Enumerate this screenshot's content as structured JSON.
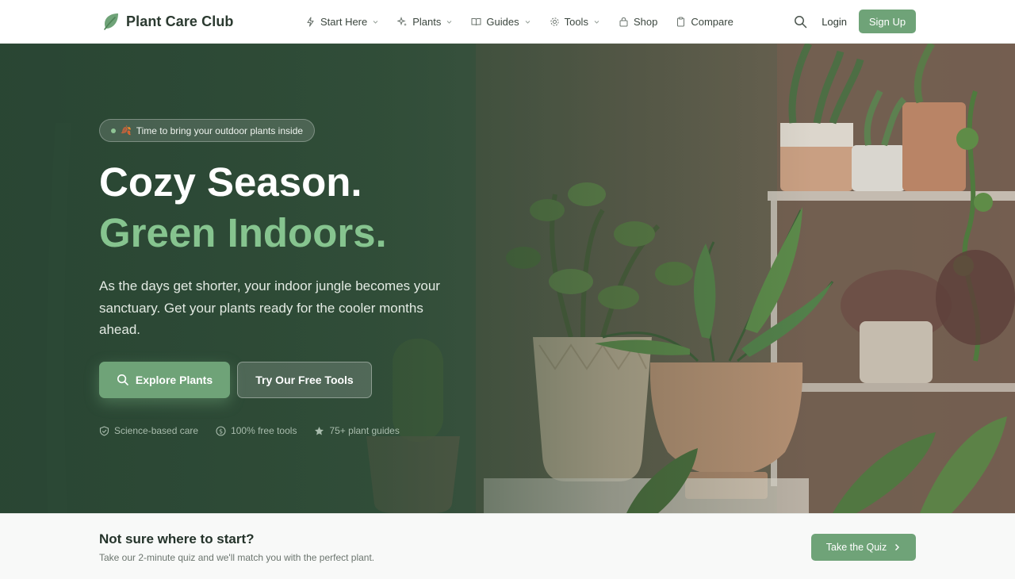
{
  "nav": {
    "brand": "Plant Care Club",
    "logo_icon": "leaf-logo-icon",
    "links": [
      {
        "label": "Start Here",
        "icon": "sparkle-icon",
        "dropdown": true
      },
      {
        "label": "Plants",
        "icon": "sparkles-icon",
        "dropdown": true
      },
      {
        "label": "Guides",
        "icon": "book-icon",
        "dropdown": true
      },
      {
        "label": "Tools",
        "icon": "gear-icon",
        "dropdown": true
      },
      {
        "label": "Shop",
        "icon": "bag-icon",
        "dropdown": false
      },
      {
        "label": "Compare",
        "icon": "clipboard-icon",
        "dropdown": false
      }
    ],
    "search_icon": "search-icon",
    "login": "Login",
    "signup": "Sign Up"
  },
  "hero": {
    "pill": "Time to bring your outdoor plants inside",
    "pill_icon": "🍂",
    "headline_line1": "Cozy Season.",
    "headline_line2": "Green Indoors.",
    "lede": "As the days get shorter, your indoor jungle becomes your sanctuary. Get your plants ready for the cooler months ahead.",
    "primary_cta": "Explore Plants",
    "secondary_cta": "Try Our Free Tools",
    "features": [
      {
        "label": "Science-based care",
        "icon": "shield-check-icon"
      },
      {
        "label": "100% free tools",
        "icon": "dollar-circle-icon"
      },
      {
        "label": "75+ plant guides",
        "icon": "star-icon"
      }
    ]
  },
  "quiz": {
    "title": "Not sure where to start?",
    "subtitle": "Take our 2-minute quiz and we'll match you with the perfect plant.",
    "button": "Take the Quiz"
  },
  "colors": {
    "accent": "#6fa378",
    "accent_light": "#86c48f",
    "hero_dark": "#2f4b37",
    "text_dark": "#24332a"
  }
}
